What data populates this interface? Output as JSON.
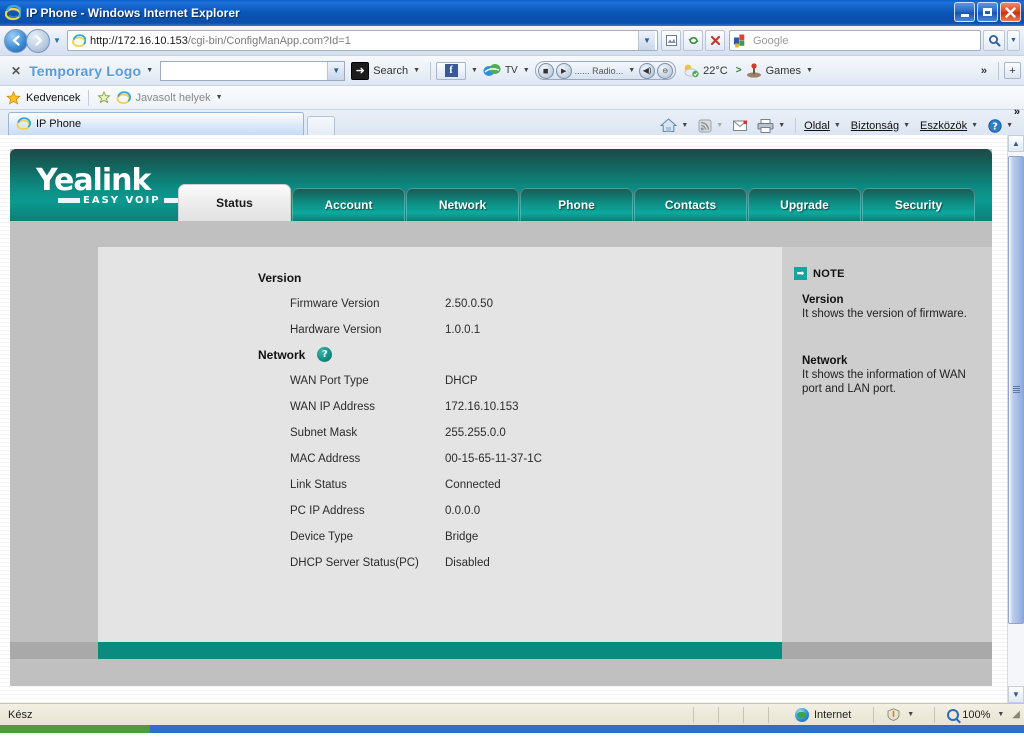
{
  "window": {
    "title": "IP Phone - Windows Internet Explorer",
    "minimize_label": "▬",
    "maximize_label": "❐",
    "close_label": "✕"
  },
  "address_bar": {
    "back_label": "◄",
    "forward_label": "►",
    "history_dropdown_label": "▼",
    "url_host": "http://172.16.10.153",
    "url_path": "/cgi-bin/ConfigManApp.com?Id=1",
    "url_dropdown_label": "▼",
    "compat_view_label": "▧",
    "refresh_label": "↯",
    "stop_label": "✕",
    "search_placeholder": "Google",
    "search_go_label": "🔍",
    "search_dropdown_label": "▼"
  },
  "addon_toolbar": {
    "close_label": "✕",
    "logo_text": "Temporary Logo",
    "logo_dropdown": "▼",
    "search_field_value": "",
    "search_button_label": "Search",
    "search_button_dropdown": "▼",
    "facebook_label": "f",
    "facebook_dropdown": "▼",
    "tv_label": "TV",
    "tv_dropdown": "▼",
    "radio_prev_label": "◼",
    "radio_play_label": "▶",
    "radio_label": "...... Radio...",
    "radio_dropdown": "▼",
    "volume_label": "🔊",
    "mute_label": "⊖",
    "temperature": "22°C",
    "games_label": "Games",
    "games_dropdown": "▼",
    "overflow_label": "»",
    "add_label": "+"
  },
  "favorites_bar": {
    "favorites_label": "Kedvencek",
    "suggested_sites_label": "Javasolt helyek",
    "suggested_dropdown": "▼"
  },
  "tab_strip": {
    "active_tab_label": "IP Phone",
    "new_tab_label": "",
    "commands": [
      {
        "label": "",
        "name": "home-icon",
        "dropdown": "▼"
      },
      {
        "label": "",
        "name": "feeds-icon",
        "dropdown": "▼"
      },
      {
        "label": "",
        "name": "mail-icon",
        "dropdown": ""
      },
      {
        "label": "",
        "name": "print-icon",
        "dropdown": "▼"
      },
      {
        "label": "Oldal",
        "name": "page-menu",
        "dropdown": "▼"
      },
      {
        "label": "Biztonság",
        "name": "security-menu",
        "dropdown": "▼"
      },
      {
        "label": "Eszközök",
        "name": "tools-menu",
        "dropdown": "▼"
      },
      {
        "label": "",
        "name": "help-menu",
        "dropdown": "▼"
      }
    ],
    "overflow_label": "»"
  },
  "app": {
    "brand": "Yealink",
    "brand_tagline": "EASY VOIP",
    "nav_tabs": [
      {
        "label": "Status",
        "active": true
      },
      {
        "label": "Account",
        "active": false
      },
      {
        "label": "Network",
        "active": false
      },
      {
        "label": "Phone",
        "active": false
      },
      {
        "label": "Contacts",
        "active": false
      },
      {
        "label": "Upgrade",
        "active": false
      },
      {
        "label": "Security",
        "active": false
      }
    ],
    "sections": [
      {
        "title": "Version",
        "has_help": false,
        "help_label": "?",
        "rows": [
          {
            "label": "Firmware Version",
            "value": "2.50.0.50"
          },
          {
            "label": "Hardware Version",
            "value": "1.0.0.1"
          }
        ]
      },
      {
        "title": "Network",
        "has_help": true,
        "help_label": "?",
        "rows": [
          {
            "label": "WAN Port Type",
            "value": "DHCP"
          },
          {
            "label": "WAN IP Address",
            "value": "172.16.10.153"
          },
          {
            "label": "Subnet Mask",
            "value": "255.255.0.0"
          },
          {
            "label": "MAC Address",
            "value": "00-15-65-11-37-1C"
          },
          {
            "label": "Link Status",
            "value": "Connected"
          },
          {
            "label": "PC IP Address",
            "value": "0.0.0.0"
          },
          {
            "label": "Device Type",
            "value": "Bridge"
          },
          {
            "label": "DHCP Server Status(PC)",
            "value": "Disabled"
          }
        ]
      }
    ],
    "note": {
      "icon_label": "➡",
      "title": "NOTE",
      "blocks": [
        {
          "heading": "Version",
          "text": "It shows the version of firmware."
        },
        {
          "heading": "Network",
          "text": "It shows the information of WAN port and LAN port."
        }
      ]
    }
  },
  "status_bar": {
    "status_text": "Kész",
    "zone_label": "Internet",
    "protected_dropdown": "▼",
    "zoom_label": "100%",
    "zoom_dropdown": "▼"
  },
  "colors": {
    "teal": "#0B8A80",
    "teal_dark": "#1D4A46",
    "title_blue": "#0A55B5",
    "panel_gray": "#E4E4E4",
    "note_gray": "#CECECE"
  }
}
